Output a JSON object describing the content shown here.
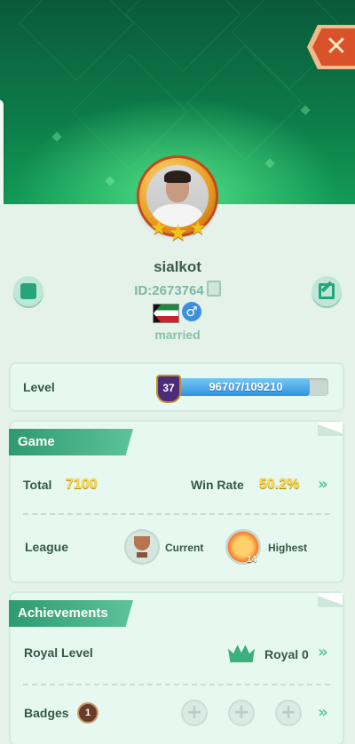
{
  "profile": {
    "username": "sialkot",
    "id_label": "ID:2673764",
    "marital_status": "married",
    "gender_symbol": "♂"
  },
  "close_button": {
    "symbol": "✕"
  },
  "level": {
    "label": "Level",
    "number": "37",
    "progress_text": "96707/109210",
    "progress_fraction": 0.885
  },
  "game": {
    "title": "Game",
    "total_label": "Total",
    "total_value": "7100",
    "win_rate_label": "Win Rate",
    "win_rate_value": "50.2%",
    "league_label": "League",
    "current_label": "Current",
    "highest_label": "Highest",
    "highest_badge_number": "14"
  },
  "achievements": {
    "title": "Achievements",
    "royal_level_label": "Royal Level",
    "royal_value": "Royal 0",
    "badges_label": "Badges",
    "badges_count": "1"
  },
  "chevron_symbol": "»",
  "plus_symbol": "+",
  "colors": {
    "accent_green": "#26a57d",
    "number_yellow": "#ffd84a",
    "close_red": "#d9522a",
    "progress_blue": "#2f93e0"
  }
}
